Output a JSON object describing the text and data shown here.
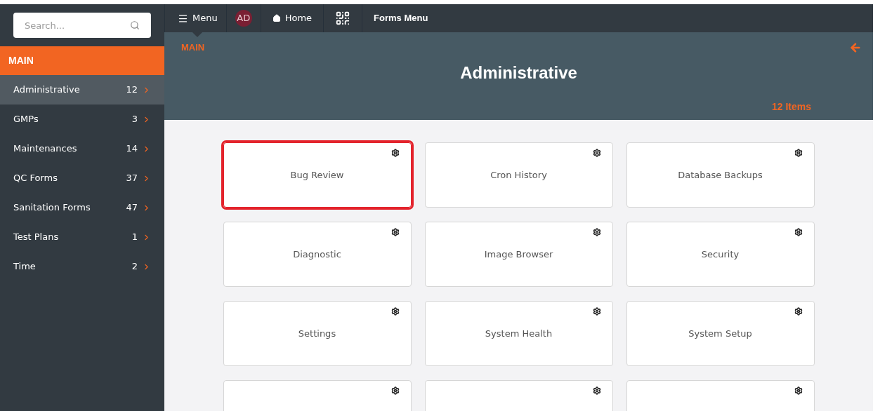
{
  "sidebar": {
    "search": {
      "placeholder": "Search..."
    },
    "section": "MAIN",
    "items": [
      {
        "label": "Administrative",
        "count": "12",
        "selected": true
      },
      {
        "label": "GMPs",
        "count": "3",
        "selected": false
      },
      {
        "label": "Maintenances",
        "count": "14",
        "selected": false
      },
      {
        "label": "QC Forms",
        "count": "37",
        "selected": false
      },
      {
        "label": "Sanitation Forms",
        "count": "47",
        "selected": false
      },
      {
        "label": "Test Plans",
        "count": "1",
        "selected": false
      },
      {
        "label": "Time",
        "count": "2",
        "selected": false
      }
    ]
  },
  "topbar": {
    "items": [
      {
        "kind": "menu",
        "label": "Menu",
        "selected": true
      },
      {
        "kind": "avatar",
        "label": "AD",
        "selected": false
      },
      {
        "kind": "home",
        "label": "Home",
        "selected": false
      },
      {
        "kind": "qr",
        "selected": false
      },
      {
        "kind": "text",
        "label": "Forms Menu",
        "selected": false
      }
    ]
  },
  "header": {
    "breadcrumb": "MAIN",
    "title": "Administrative",
    "count": "12 Items"
  },
  "cards": [
    {
      "label": "Bug Review",
      "highlighted": true
    },
    {
      "label": "Cron History",
      "highlighted": false
    },
    {
      "label": "Database Backups",
      "highlighted": false
    },
    {
      "label": "Diagnostic",
      "highlighted": false
    },
    {
      "label": "Image Browser",
      "highlighted": false
    },
    {
      "label": "Security",
      "highlighted": false
    },
    {
      "label": "Settings",
      "highlighted": false
    },
    {
      "label": "System Health",
      "highlighted": false
    },
    {
      "label": "System Setup",
      "highlighted": false
    },
    {
      "highlighted": false
    },
    {
      "highlighted": false
    },
    {
      "highlighted": false
    }
  ]
}
